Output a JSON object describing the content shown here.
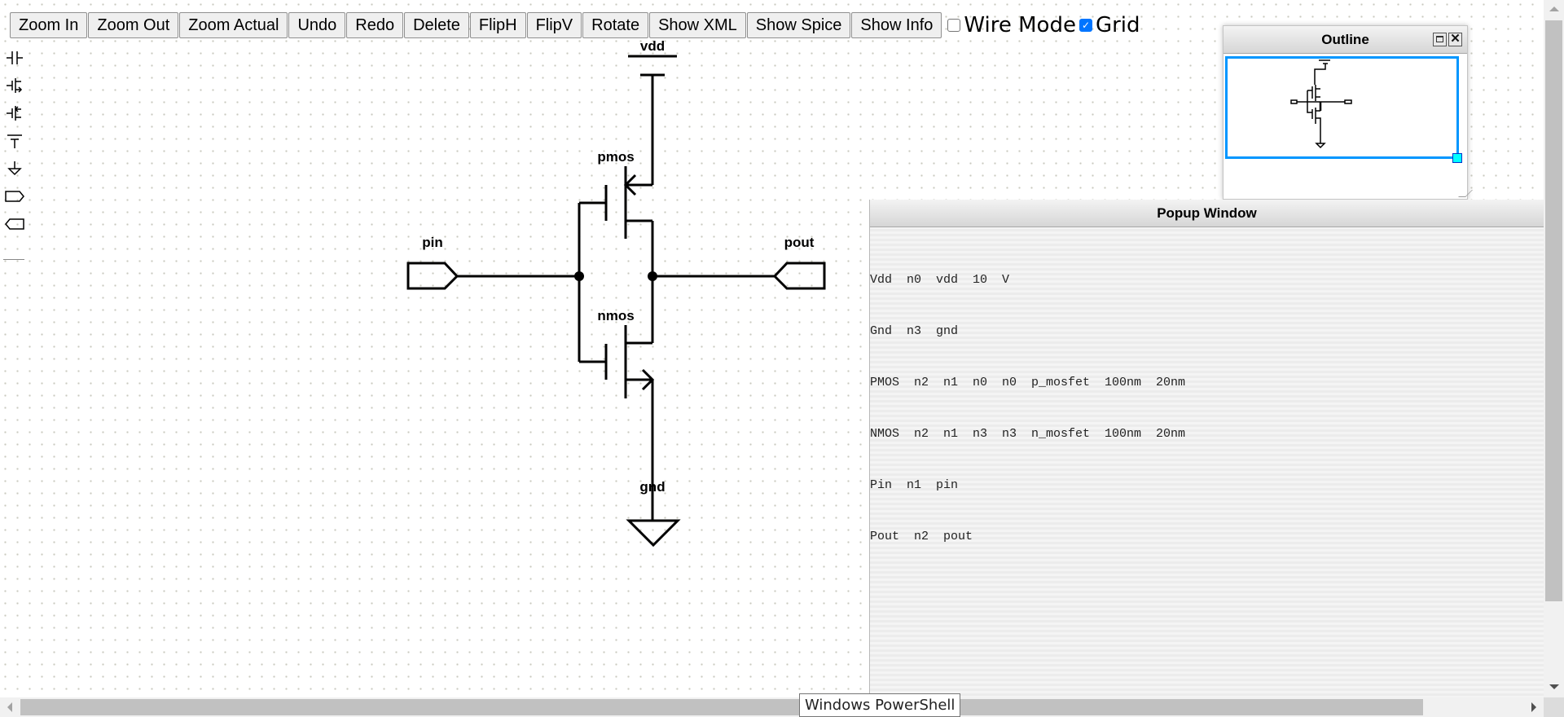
{
  "toolbar": {
    "buttons": [
      {
        "id": "zoom-in",
        "label": "Zoom In"
      },
      {
        "id": "zoom-out",
        "label": "Zoom Out"
      },
      {
        "id": "zoom-actual",
        "label": "Zoom Actual"
      },
      {
        "id": "undo",
        "label": "Undo"
      },
      {
        "id": "redo",
        "label": "Redo"
      },
      {
        "id": "delete",
        "label": "Delete"
      },
      {
        "id": "fliph",
        "label": "FlipH"
      },
      {
        "id": "flipv",
        "label": "FlipV"
      },
      {
        "id": "rotate",
        "label": "Rotate"
      },
      {
        "id": "show-xml",
        "label": "Show XML"
      },
      {
        "id": "show-spice",
        "label": "Show Spice"
      },
      {
        "id": "show-info",
        "label": "Show Info"
      }
    ],
    "wire_mode": {
      "label": "Wire Mode",
      "checked": false
    },
    "grid": {
      "label": "Grid",
      "checked": true
    }
  },
  "palette": {
    "items": [
      {
        "icon": "resistor-icon"
      },
      {
        "icon": "capacitor-icon"
      },
      {
        "icon": "nmos-icon"
      },
      {
        "icon": "pmos-icon"
      },
      {
        "icon": "vdd-icon"
      },
      {
        "icon": "ground-icon"
      },
      {
        "icon": "input-pin-icon"
      },
      {
        "icon": "output-pin-icon"
      }
    ]
  },
  "schematic": {
    "labels": {
      "vdd": "vdd",
      "pmos": "pmos",
      "nmos": "nmos",
      "gnd": "gnd",
      "pin": "pin",
      "pout": "pout"
    }
  },
  "outline_window": {
    "title": "Outline"
  },
  "popup_window": {
    "title": "Popup Window",
    "lines": [
      "Vdd  n0  vdd  10  V",
      "Gnd  n3  gnd",
      "PMOS  n2  n1  n0  n0  p_mosfet  100nm  20nm",
      "NMOS  n2  n1  n3  n3  n_mosfet  100nm  20nm",
      "Pin  n1  pin",
      "Pout  n2  pout"
    ]
  },
  "tooltip": {
    "text": "Windows PowerShell"
  },
  "colors": {
    "outline_view": "#0096ff",
    "outline_handle": "#00ffff",
    "checkbox_accent": "#0075ff"
  }
}
